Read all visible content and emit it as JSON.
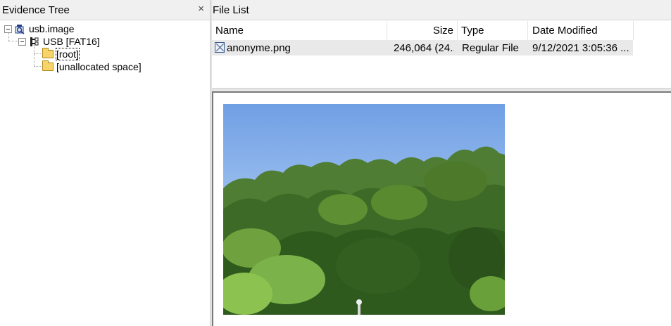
{
  "evidence_tree": {
    "title": "Evidence Tree",
    "close_glyph": "×",
    "nodes": [
      {
        "label": "usb.image"
      },
      {
        "label": "USB [FAT16]"
      },
      {
        "label": "[root]"
      },
      {
        "label": "[unallocated space]"
      }
    ]
  },
  "file_list": {
    "title": "File List",
    "columns": [
      "Name",
      "Size",
      "Type",
      "Date Modified"
    ],
    "rows": [
      {
        "name": "anonyme.png",
        "size": "246,064 (24...",
        "type": "Regular File",
        "date_modified": "9/12/2021 3:05:36 ..."
      }
    ]
  },
  "preview": {
    "image_icon": "photo-preview"
  },
  "colors": {
    "header_bg": "#f0f0f0",
    "selected_row_bg": "#e9e9e9",
    "folder": "#f6d469"
  }
}
